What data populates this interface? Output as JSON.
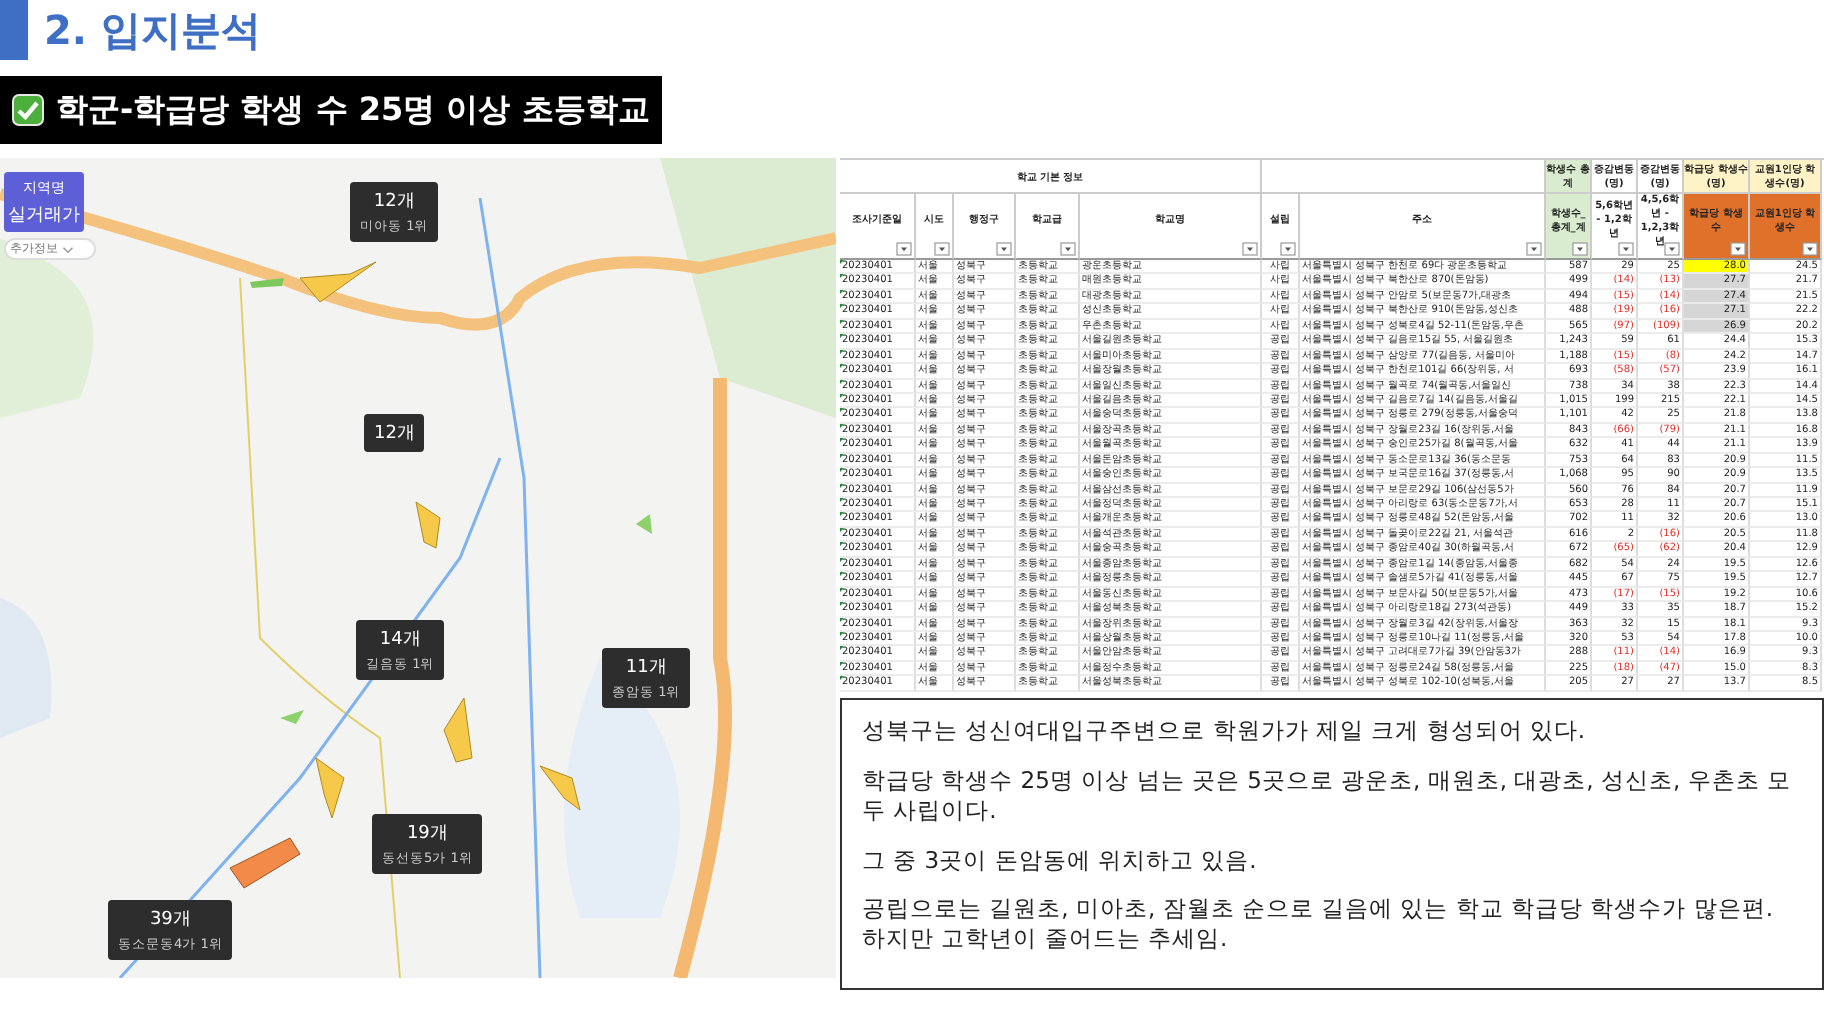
{
  "title": "2. 입지분석",
  "subtitle": "학군-학급당 학생 수 25명 이상 초등학교",
  "map": {
    "region_button": {
      "line1": "지역명",
      "line2": "실거래가"
    },
    "info_button": "추가정보",
    "markers": [
      {
        "count": "12개",
        "label": "미아동 1위"
      },
      {
        "count": "12개"
      },
      {
        "count": "14개",
        "label": "길음동 1위"
      },
      {
        "count": "11개",
        "label": "종암동 1위"
      },
      {
        "count": "19개",
        "label": "동선동5가 1위"
      },
      {
        "count": "39개",
        "label": "동소문동4가 1위"
      }
    ]
  },
  "table": {
    "groups": [
      "학교 기본 정보",
      "학생수 총계",
      "증감변동(명)",
      "증감변동(명)",
      "학급당 학생수(명)",
      "교원1인당 학생수(명)"
    ],
    "columns": [
      "조사기준일",
      "시도",
      "행정구",
      "학교급",
      "학교명",
      "설립",
      "주소",
      "학생수_총계_계",
      "5,6학년 - 1,2학년",
      "4,5,6학년 - 1,2,3학년",
      "학급당 학생수",
      "교원1인당 학생수"
    ],
    "rows": [
      {
        "date": "20230401",
        "sido": "서울",
        "gu": "성북구",
        "level": "초등학교",
        "school": "광운초등학교",
        "type": "사립",
        "address": "서울특별시 성북구 한천로 69다 광운초등학교",
        "students": "587",
        "change_a": {
          "text": "29",
          "decrease": false
        },
        "change_b": {
          "text": "25",
          "decrease": false
        },
        "per_class": "28.0",
        "per_teacher": "24.5",
        "color": "#ffff00"
      },
      {
        "date": "20230401",
        "sido": "서울",
        "gu": "성북구",
        "level": "초등학교",
        "school": "매원초등학교",
        "type": "사립",
        "address": "서울특별시 성북구 북한산로 870(돈암동)",
        "students": "499",
        "change_a": {
          "text": "(14)",
          "decrease": true
        },
        "change_b": {
          "text": "(13)",
          "decrease": true
        },
        "per_class": "27.7",
        "per_teacher": "21.7",
        "color": "#d6d6d6"
      },
      {
        "date": "20230401",
        "sido": "서울",
        "gu": "성북구",
        "level": "초등학교",
        "school": "대광초등학교",
        "type": "사립",
        "address": "서울특별시 성북구 안암로 5(보문동7가,대광초",
        "students": "494",
        "change_a": {
          "text": "(15)",
          "decrease": true
        },
        "change_b": {
          "text": "(14)",
          "decrease": true
        },
        "per_class": "27.4",
        "per_teacher": "21.5",
        "color": "#d6d6d6"
      },
      {
        "date": "20230401",
        "sido": "서울",
        "gu": "성북구",
        "level": "초등학교",
        "school": "성신초등학교",
        "type": "사립",
        "address": "서울특별시 성북구 북한산로 910(돈암동,성신초",
        "students": "488",
        "change_a": {
          "text": "(19)",
          "decrease": true
        },
        "change_b": {
          "text": "(16)",
          "decrease": true
        },
        "per_class": "27.1",
        "per_teacher": "22.2",
        "color": "#d6d6d6"
      },
      {
        "date": "20230401",
        "sido": "서울",
        "gu": "성북구",
        "level": "초등학교",
        "school": "우촌초등학교",
        "type": "사립",
        "address": "서울특별시 성북구 성북로4길 52-11(돈암동,우촌",
        "students": "565",
        "change_a": {
          "text": "(97)",
          "decrease": true
        },
        "change_b": {
          "text": "(109)",
          "decrease": true
        },
        "per_class": "26.9",
        "per_teacher": "20.2",
        "color": "#d6d6d6"
      },
      {
        "date": "20230401",
        "sido": "서울",
        "gu": "성북구",
        "level": "초등학교",
        "school": "서울길원초등학교",
        "type": "공립",
        "address": "서울특별시 성북구 길음로15길 55, 서울길원초",
        "students": "1,243",
        "change_a": {
          "text": "59",
          "decrease": false
        },
        "change_b": {
          "text": "61",
          "decrease": false
        },
        "per_class": "24.4",
        "per_teacher": "15.3"
      },
      {
        "date": "20230401",
        "sido": "서울",
        "gu": "성북구",
        "level": "초등학교",
        "school": "서울미아초등학교",
        "type": "공립",
        "address": "서울특별시 성북구 삼양로 77(길음동, 서울미아",
        "students": "1,188",
        "change_a": {
          "text": "(15)",
          "decrease": true
        },
        "change_b": {
          "text": "(8)",
          "decrease": true
        },
        "per_class": "24.2",
        "per_teacher": "14.7"
      },
      {
        "date": "20230401",
        "sido": "서울",
        "gu": "성북구",
        "level": "초등학교",
        "school": "서울장월초등학교",
        "type": "공립",
        "address": "서울특별시 성북구 한천로101길 66(장위동, 서",
        "students": "693",
        "change_a": {
          "text": "(58)",
          "decrease": true
        },
        "change_b": {
          "text": "(57)",
          "decrease": true
        },
        "per_class": "23.9",
        "per_teacher": "16.1"
      },
      {
        "date": "20230401",
        "sido": "서울",
        "gu": "성북구",
        "level": "초등학교",
        "school": "서울일신초등학교",
        "type": "공립",
        "address": "서울특별시 성북구 월곡로 74(월곡동,서울일신",
        "students": "738",
        "change_a": {
          "text": "34",
          "decrease": false
        },
        "change_b": {
          "text": "38",
          "decrease": false
        },
        "per_class": "22.3",
        "per_teacher": "14.4"
      },
      {
        "date": "20230401",
        "sido": "서울",
        "gu": "성북구",
        "level": "초등학교",
        "school": "서울길음초등학교",
        "type": "공립",
        "address": "서울특별시 성북구 길음로7길 14(길음동,서울길",
        "students": "1,015",
        "change_a": {
          "text": "199",
          "decrease": false
        },
        "change_b": {
          "text": "215",
          "decrease": false
        },
        "per_class": "22.1",
        "per_teacher": "14.5"
      },
      {
        "date": "20230401",
        "sido": "서울",
        "gu": "성북구",
        "level": "초등학교",
        "school": "서울숭덕초등학교",
        "type": "공립",
        "address": "서울특별시 성북구 정릉로 279(정릉동,서울숭덕",
        "students": "1,101",
        "change_a": {
          "text": "42",
          "decrease": false
        },
        "change_b": {
          "text": "25",
          "decrease": false
        },
        "per_class": "21.8",
        "per_teacher": "13.8"
      },
      {
        "date": "20230401",
        "sido": "서울",
        "gu": "성북구",
        "level": "초등학교",
        "school": "서울장곡초등학교",
        "type": "공립",
        "address": "서울특별시 성북구 장월로23길 16(장위동,서울",
        "students": "843",
        "change_a": {
          "text": "(66)",
          "decrease": true
        },
        "change_b": {
          "text": "(79)",
          "decrease": true
        },
        "per_class": "21.1",
        "per_teacher": "16.8"
      },
      {
        "date": "20230401",
        "sido": "서울",
        "gu": "성북구",
        "level": "초등학교",
        "school": "서울월곡초등학교",
        "type": "공립",
        "address": "서울특별시 성북구 숭인로25가길 8(월곡동,서울",
        "students": "632",
        "change_a": {
          "text": "41",
          "decrease": false
        },
        "change_b": {
          "text": "44",
          "decrease": false
        },
        "per_class": "21.1",
        "per_teacher": "13.9"
      },
      {
        "date": "20230401",
        "sido": "서울",
        "gu": "성북구",
        "level": "초등학교",
        "school": "서울돈암초등학교",
        "type": "공립",
        "address": "서울특별시 성북구 동소문로13길 36(동소문동",
        "students": "753",
        "change_a": {
          "text": "64",
          "decrease": false
        },
        "change_b": {
          "text": "83",
          "decrease": false
        },
        "per_class": "20.9",
        "per_teacher": "11.5"
      },
      {
        "date": "20230401",
        "sido": "서울",
        "gu": "성북구",
        "level": "초등학교",
        "school": "서울숭인초등학교",
        "type": "공립",
        "address": "서울특별시 성북구 보국문로16길 37(정릉동,서",
        "students": "1,068",
        "change_a": {
          "text": "95",
          "decrease": false
        },
        "change_b": {
          "text": "90",
          "decrease": false
        },
        "per_class": "20.9",
        "per_teacher": "13.5"
      },
      {
        "date": "20230401",
        "sido": "서울",
        "gu": "성북구",
        "level": "초등학교",
        "school": "서울삼선초등학교",
        "type": "공립",
        "address": "서울특별시 성북구 보문로29길 106(삼선동5가",
        "students": "560",
        "change_a": {
          "text": "76",
          "decrease": false
        },
        "change_b": {
          "text": "84",
          "decrease": false
        },
        "per_class": "20.7",
        "per_teacher": "11.9"
      },
      {
        "date": "20230401",
        "sido": "서울",
        "gu": "성북구",
        "level": "초등학교",
        "school": "서울정덕초등학교",
        "type": "공립",
        "address": "서울특별시 성북구 아리랑로 63(동소문동7가,서",
        "students": "653",
        "change_a": {
          "text": "28",
          "decrease": false
        },
        "change_b": {
          "text": "11",
          "decrease": false
        },
        "per_class": "20.7",
        "per_teacher": "15.1"
      },
      {
        "date": "20230401",
        "sido": "서울",
        "gu": "성북구",
        "level": "초등학교",
        "school": "서울개운초등학교",
        "type": "공립",
        "address": "서울특별시 성북구 정릉로48길 52(돈암동,서울",
        "students": "702",
        "change_a": {
          "text": "11",
          "decrease": false
        },
        "change_b": {
          "text": "32",
          "decrease": false
        },
        "per_class": "20.6",
        "per_teacher": "13.0"
      },
      {
        "date": "20230401",
        "sido": "서울",
        "gu": "성북구",
        "level": "초등학교",
        "school": "서울석관초등학교",
        "type": "공립",
        "address": "서울특별시 성북구 돌곶이로22길 21, 서울석관",
        "students": "616",
        "change_a": {
          "text": "2",
          "decrease": false
        },
        "change_b": {
          "text": "(16)",
          "decrease": true
        },
        "per_class": "20.5",
        "per_teacher": "11.8"
      },
      {
        "date": "20230401",
        "sido": "서울",
        "gu": "성북구",
        "level": "초등학교",
        "school": "서울숭곡초등학교",
        "type": "공립",
        "address": "서울특별시 성북구 종암로40길 30(하월곡동,서",
        "students": "672",
        "change_a": {
          "text": "(65)",
          "decrease": true
        },
        "change_b": {
          "text": "(62)",
          "decrease": true
        },
        "per_class": "20.4",
        "per_teacher": "12.9"
      },
      {
        "date": "20230401",
        "sido": "서울",
        "gu": "성북구",
        "level": "초등학교",
        "school": "서울종암초등학교",
        "type": "공립",
        "address": "서울특별시 성북구 종암로1길 14(종암동,서울종",
        "students": "682",
        "change_a": {
          "text": "54",
          "decrease": false
        },
        "change_b": {
          "text": "24",
          "decrease": false
        },
        "per_class": "19.5",
        "per_teacher": "12.6"
      },
      {
        "date": "20230401",
        "sido": "서울",
        "gu": "성북구",
        "level": "초등학교",
        "school": "서울정릉초등학교",
        "type": "공립",
        "address": "서울특별시 성북구 솔샘로5가길 41(정릉동,서울",
        "students": "445",
        "change_a": {
          "text": "67",
          "decrease": false
        },
        "change_b": {
          "text": "75",
          "decrease": false
        },
        "per_class": "19.5",
        "per_teacher": "12.7"
      },
      {
        "date": "20230401",
        "sido": "서울",
        "gu": "성북구",
        "level": "초등학교",
        "school": "서울동신초등학교",
        "type": "공립",
        "address": "서울특별시 성북구 보문사길 50(보문동5가,서울",
        "students": "473",
        "change_a": {
          "text": "(17)",
          "decrease": true
        },
        "change_b": {
          "text": "(15)",
          "decrease": true
        },
        "per_class": "19.2",
        "per_teacher": "10.6"
      },
      {
        "date": "20230401",
        "sido": "서울",
        "gu": "성북구",
        "level": "초등학교",
        "school": "서울성북초등학교",
        "type": "공립",
        "address": "서울특별시 성북구 아리랑로18길 273(석관동)",
        "students": "449",
        "change_a": {
          "text": "33",
          "decrease": false
        },
        "change_b": {
          "text": "35",
          "decrease": false
        },
        "per_class": "18.7",
        "per_teacher": "15.2"
      },
      {
        "date": "20230401",
        "sido": "서울",
        "gu": "성북구",
        "level": "초등학교",
        "school": "서울장위초등학교",
        "type": "공립",
        "address": "서울특별시 성북구 장월로3길 42(장위동,서울장",
        "students": "363",
        "change_a": {
          "text": "32",
          "decrease": false
        },
        "change_b": {
          "text": "15",
          "decrease": false
        },
        "per_class": "18.1",
        "per_teacher": "9.3"
      },
      {
        "date": "20230401",
        "sido": "서울",
        "gu": "성북구",
        "level": "초등학교",
        "school": "서울상월초등학교",
        "type": "공립",
        "address": "서울특별시 성북구 정릉로10나길 11(정릉동,서울",
        "students": "320",
        "change_a": {
          "text": "53",
          "decrease": false
        },
        "change_b": {
          "text": "54",
          "decrease": false
        },
        "per_class": "17.8",
        "per_teacher": "10.0"
      },
      {
        "date": "20230401",
        "sido": "서울",
        "gu": "성북구",
        "level": "초등학교",
        "school": "서울안암초등학교",
        "type": "공립",
        "address": "서울특별시 성북구 고려대로7가길 39(안암동3가",
        "students": "288",
        "change_a": {
          "text": "(11)",
          "decrease": true
        },
        "change_b": {
          "text": "(14)",
          "decrease": true
        },
        "per_class": "16.9",
        "per_teacher": "9.3"
      },
      {
        "date": "20230401",
        "sido": "서울",
        "gu": "성북구",
        "level": "초등학교",
        "school": "서울정수초등학교",
        "type": "공립",
        "address": "서울특별시 성북구 정릉로24길 58(정릉동,서울",
        "students": "225",
        "change_a": {
          "text": "(18)",
          "decrease": true
        },
        "change_b": {
          "text": "(47)",
          "decrease": true
        },
        "per_class": "15.0",
        "per_teacher": "8.3"
      },
      {
        "date": "20230401",
        "sido": "서울",
        "gu": "성북구",
        "level": "초등학교",
        "school": "서울성북초등학교",
        "type": "공립",
        "address": "서울특별시 성북구 성북로 102-10(성북동,서울",
        "students": "205",
        "change_a": {
          "text": "27",
          "decrease": false
        },
        "change_b": {
          "text": "27",
          "decrease": false
        },
        "per_class": "13.7",
        "per_teacher": "8.5"
      }
    ]
  },
  "notes": [
    [
      "성북구는 성신여대입구주변으로 학원가가 제일 크게 형성되어 있다."
    ],
    [
      "학급당 학생수 25명 이상 넘는 곳은 5곳으로 광운초, 매원초, 대광초, 성신초, 우촌초 모두 사립이다."
    ],
    [
      "그 중 3곳이 돈암동에 위치하고 있음."
    ],
    [
      "공립으로는 길원초, 미아초, 잠월초 순으로 길음에 있는 학교 학급당 학생수가 많은편.",
      "하지만 고학년이 줄어드는 추세임."
    ]
  ]
}
